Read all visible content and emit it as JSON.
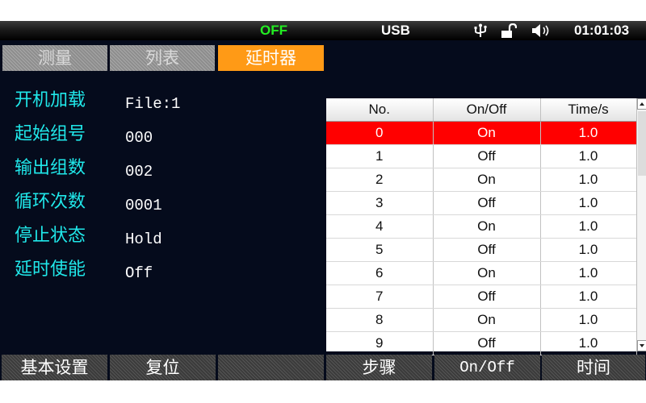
{
  "status_bar": {
    "output_state": "OFF",
    "interface": "USB",
    "time": "01:01:03",
    "output_state_color": "#22ee22",
    "icons": [
      "usb-icon",
      "unlock-icon",
      "speaker-icon"
    ]
  },
  "tabs": [
    {
      "label": "测量",
      "active": false
    },
    {
      "label": "列表",
      "active": false
    },
    {
      "label": "延时器",
      "active": true
    }
  ],
  "settings": [
    {
      "label": "开机加载",
      "value": "File:1"
    },
    {
      "label": "起始组号",
      "value": "000"
    },
    {
      "label": "输出组数",
      "value": "002"
    },
    {
      "label": "循环次数",
      "value": "0001"
    },
    {
      "label": "停止状态",
      "value": "Hold"
    },
    {
      "label": "延时使能",
      "value": "Off"
    }
  ],
  "table": {
    "headers": [
      "No.",
      "On/Off",
      "Time/s"
    ],
    "selected_row": 0,
    "rows": [
      [
        "0",
        "On",
        "1.0"
      ],
      [
        "1",
        "Off",
        "1.0"
      ],
      [
        "2",
        "On",
        "1.0"
      ],
      [
        "3",
        "Off",
        "1.0"
      ],
      [
        "4",
        "On",
        "1.0"
      ],
      [
        "5",
        "Off",
        "1.0"
      ],
      [
        "6",
        "On",
        "1.0"
      ],
      [
        "7",
        "Off",
        "1.0"
      ],
      [
        "8",
        "On",
        "1.0"
      ],
      [
        "9",
        "Off",
        "1.0"
      ]
    ]
  },
  "softkeys": [
    "基本设置",
    "复位",
    "",
    "步骤",
    "On/Off",
    "时间"
  ],
  "colors": {
    "accent_tab": "#ff9a16",
    "label_cyan": "#20e8ea",
    "selected_row": "#ff0000",
    "screen_bg": "#050b1c"
  }
}
